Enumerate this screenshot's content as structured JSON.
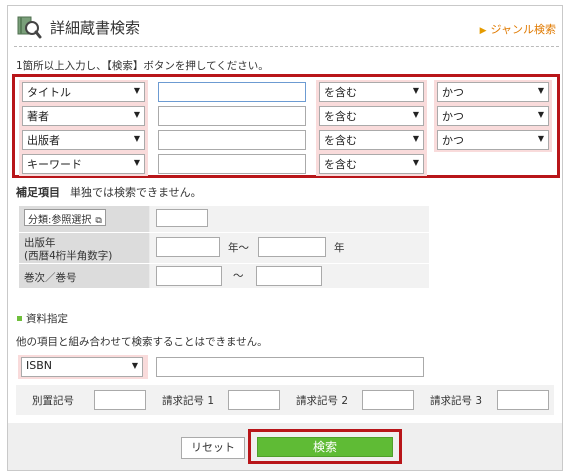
{
  "header": {
    "title": "詳細蔵書検索",
    "genre_link": "ジャンル検索"
  },
  "instruction": "1箇所以上入力し、【検索】ボタンを押してください。",
  "criteria": [
    {
      "field": "タイトル",
      "value": "",
      "match": "を含む",
      "op": "かつ"
    },
    {
      "field": "著者",
      "value": "",
      "match": "を含む",
      "op": "かつ"
    },
    {
      "field": "出版者",
      "value": "",
      "match": "を含む",
      "op": "かつ"
    },
    {
      "field": "キーワード",
      "value": "",
      "match": "を含む",
      "op": ""
    }
  ],
  "supplement": {
    "title": "補足項目",
    "note": "単独では検索できません。",
    "classification_button": "分類:参照選択",
    "pub_year_label_1": "出版年",
    "pub_year_label_2": "(西暦4桁半角数字)",
    "year_from_suffix": "年～",
    "year_to_suffix": "年",
    "volume_label": "巻次／巻号",
    "volume_sep": "～"
  },
  "material": {
    "title": "資料指定",
    "note": "他の項目と組み合わせて検索することはできません。",
    "id_type": "ISBN",
    "id_value": "",
    "call_labels": [
      "別置記号",
      "請求記号 1",
      "請求記号 2",
      "請求記号 3"
    ]
  },
  "buttons": {
    "reset": "リセット",
    "search": "検索"
  },
  "colors": {
    "accent_red": "#b81519",
    "search_green": "#5fbb35",
    "link_orange": "#e07a00"
  }
}
